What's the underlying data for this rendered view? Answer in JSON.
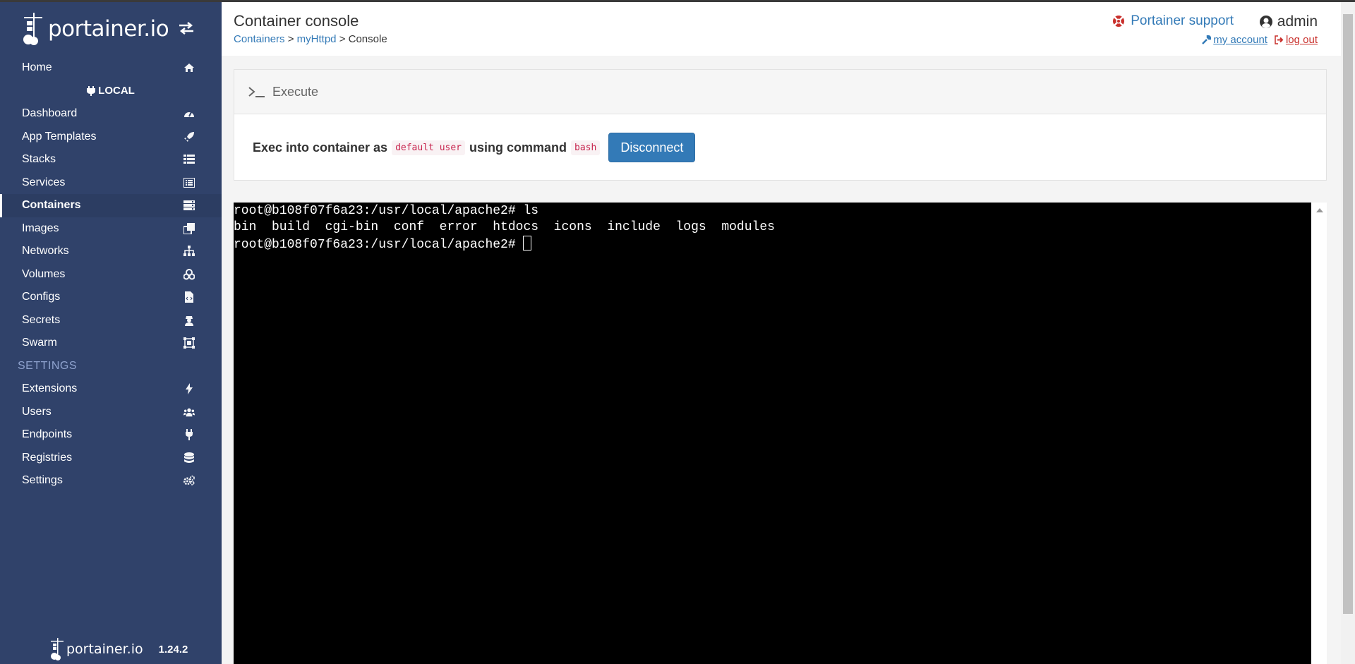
{
  "sidebar": {
    "brand": "portainer.io",
    "environment": "LOCAL",
    "items": [
      {
        "label": "Home",
        "icon": "home-icon"
      },
      {
        "label": "Dashboard",
        "icon": "dashboard-icon"
      },
      {
        "label": "App Templates",
        "icon": "rocket-icon"
      },
      {
        "label": "Stacks",
        "icon": "th-list-icon"
      },
      {
        "label": "Services",
        "icon": "list-alt-icon"
      },
      {
        "label": "Containers",
        "icon": "server-icon",
        "active": true
      },
      {
        "label": "Images",
        "icon": "clone-icon"
      },
      {
        "label": "Networks",
        "icon": "sitemap-icon"
      },
      {
        "label": "Volumes",
        "icon": "cubes-icon"
      },
      {
        "label": "Configs",
        "icon": "file-code-icon"
      },
      {
        "label": "Secrets",
        "icon": "user-secret-icon"
      },
      {
        "label": "Swarm",
        "icon": "object-group-icon"
      }
    ],
    "settings_title": "SETTINGS",
    "settings_items": [
      {
        "label": "Extensions",
        "icon": "bolt-icon"
      },
      {
        "label": "Users",
        "icon": "users-icon"
      },
      {
        "label": "Endpoints",
        "icon": "plug-icon"
      },
      {
        "label": "Registries",
        "icon": "database-icon"
      },
      {
        "label": "Settings",
        "icon": "cogs-icon"
      }
    ],
    "footer_brand": "portainer.io",
    "version": "1.24.2"
  },
  "header": {
    "title": "Container console",
    "breadcrumb": {
      "part1": "Containers",
      "part2": "myHttpd",
      "current": "Console",
      "sep": ">"
    },
    "support": "Portainer support",
    "username": "admin",
    "my_account": "my account",
    "logout": "log out"
  },
  "widget": {
    "title": "Execute",
    "text_prefix": "Exec into container as",
    "user": "default user",
    "text_mid": "using command",
    "command": "bash",
    "button": "Disconnect"
  },
  "terminal": {
    "lines": [
      "root@b108f07f6a23:/usr/local/apache2# ls",
      "bin  build  cgi-bin  conf  error  htdocs  icons  include  logs  modules",
      "root@b108f07f6a23:/usr/local/apache2# "
    ]
  },
  "colors": {
    "sidebar": "#30426a",
    "accent": "#337ab7",
    "danger": "#c9302c"
  }
}
